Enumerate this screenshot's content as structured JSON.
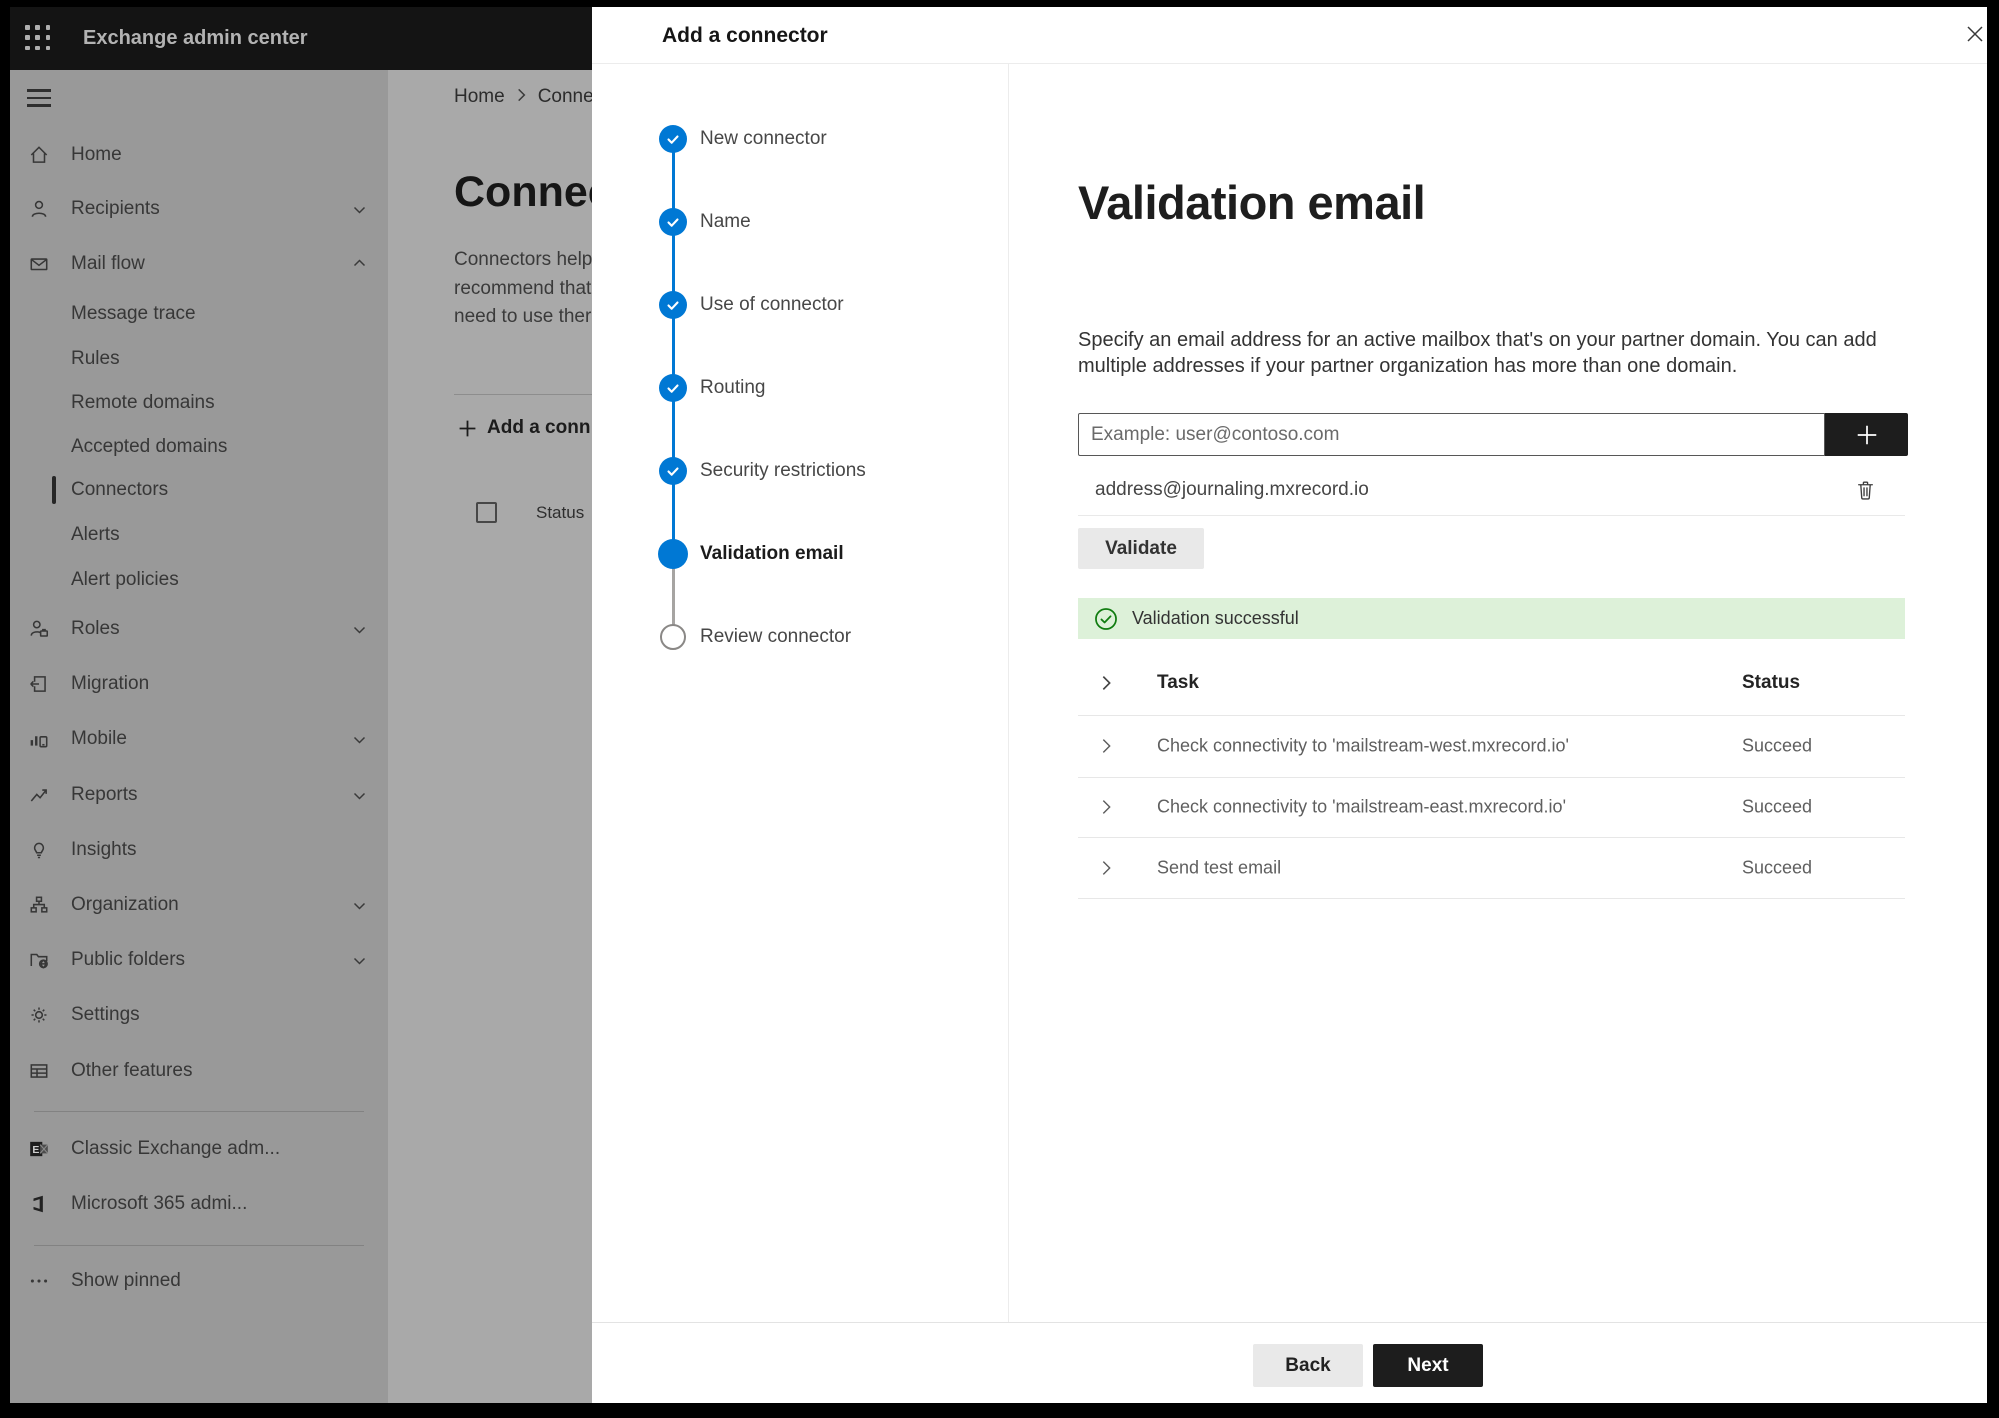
{
  "app_bar": {
    "title": "Exchange admin center"
  },
  "sidebar": {
    "items": [
      {
        "label": "Home"
      },
      {
        "label": "Recipients"
      },
      {
        "label": "Mail flow"
      },
      {
        "label": "Message trace"
      },
      {
        "label": "Rules"
      },
      {
        "label": "Remote domains"
      },
      {
        "label": "Accepted domains"
      },
      {
        "label": "Connectors"
      },
      {
        "label": "Alerts"
      },
      {
        "label": "Alert policies"
      },
      {
        "label": "Roles"
      },
      {
        "label": "Migration"
      },
      {
        "label": "Mobile"
      },
      {
        "label": "Reports"
      },
      {
        "label": "Insights"
      },
      {
        "label": "Organization"
      },
      {
        "label": "Public folders"
      },
      {
        "label": "Settings"
      },
      {
        "label": "Other features"
      },
      {
        "label": "Classic Exchange adm..."
      },
      {
        "label": "Microsoft 365 admi..."
      },
      {
        "label": "Show pinned"
      }
    ]
  },
  "background_page": {
    "breadcrumb_home": "Home",
    "breadcrumb_current": "Conne",
    "heading": "Connec",
    "description_lines": [
      "Connectors help",
      "recommend that",
      "need to use ther"
    ],
    "add_button_label": "Add a conn",
    "status_column_header": "Status"
  },
  "panel": {
    "title": "Add a connector",
    "steps": [
      {
        "label": "New connector",
        "state": "done"
      },
      {
        "label": "Name",
        "state": "done"
      },
      {
        "label": "Use of connector",
        "state": "done"
      },
      {
        "label": "Routing",
        "state": "done"
      },
      {
        "label": "Security restrictions",
        "state": "done"
      },
      {
        "label": "Validation email",
        "state": "active"
      },
      {
        "label": "Review connector",
        "state": "todo"
      }
    ],
    "content": {
      "heading": "Validation email",
      "description_lines": [
        "Specify an email address for an active mailbox that's on your partner domain. You can add",
        "multiple addresses if your partner organization has more than one domain."
      ],
      "email_input_placeholder": "Example: user@contoso.com",
      "added_address": "address@journaling.mxrecord.io",
      "validate_button": "Validate",
      "success_message": "Validation successful",
      "results_table": {
        "task_header": "Task",
        "status_header": "Status",
        "rows": [
          {
            "task": "Check connectivity to 'mailstream-west.mxrecord.io'",
            "status": "Succeed"
          },
          {
            "task": "Check connectivity to 'mailstream-east.mxrecord.io'",
            "status": "Succeed"
          },
          {
            "task": "Send test email",
            "status": "Succeed"
          }
        ]
      }
    },
    "footer": {
      "back_label": "Back",
      "next_label": "Next"
    }
  },
  "colors": {
    "accent_blue": "#0078d4",
    "success_green": "#107c10",
    "success_background": "#ddf1d9"
  }
}
